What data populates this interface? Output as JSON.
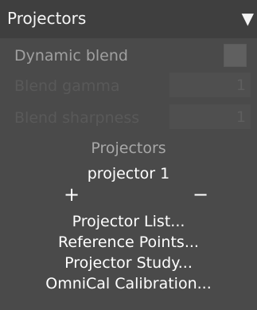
{
  "header": {
    "title": "Projectors",
    "collapse_glyph": "▼",
    "collapse_icon": "triangle-down-icon"
  },
  "dynamic_blend": {
    "label": "Dynamic blend",
    "checked": false
  },
  "blend_gamma": {
    "label": "Blend gamma",
    "value": "1"
  },
  "blend_sharpness": {
    "label": "Blend sharpness",
    "value": "1"
  },
  "projectors": {
    "section_label": "Projectors",
    "selected": "projector 1",
    "add_glyph": "+",
    "remove_glyph": "−",
    "add_icon": "plus-icon",
    "remove_icon": "minus-icon"
  },
  "actions": [
    {
      "label": "Projector List..."
    },
    {
      "label": "Reference Points..."
    },
    {
      "label": "Projector Study..."
    },
    {
      "label": "OmniCal Calibration..."
    }
  ],
  "colors": {
    "panel_background": "#4a4a4a",
    "header_background": "#3f3f3f",
    "text_primary": "#ffffff",
    "text_muted": "#a8a8a8",
    "text_disabled": "#595959"
  }
}
